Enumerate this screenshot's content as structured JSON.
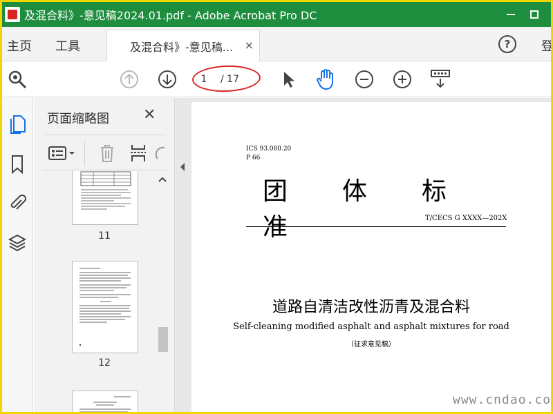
{
  "window": {
    "title": "及混合料》-意见稿2024.01.pdf - Adobe Acrobat Pro DC",
    "watermark_top": "cndao"
  },
  "menu": {
    "home": "主页",
    "tools": "工具",
    "login": "登"
  },
  "tab": {
    "label": "及混合料》-意见稿...",
    "close": "×"
  },
  "toolbar": {
    "current_page": "1",
    "total_pages": "/ 17"
  },
  "sidebar": {
    "title": "页面缩略图",
    "close": "✕",
    "thumbnails": [
      {
        "label": "11"
      },
      {
        "label": "12"
      }
    ]
  },
  "document": {
    "ics": "ICS 93.080.20",
    "p_code": "P 66",
    "heading_chars": [
      "团",
      "体",
      "标",
      "准"
    ],
    "standard_code": "T/CECS G XXXX—202X",
    "title_cn": "道路自清洁改性沥青及混合料",
    "title_en": "Self-cleaning modified asphalt and asphalt mixtures for road",
    "draft_note": "（征求意见稿）"
  },
  "footer": {
    "watermark": "www.cndao.com"
  },
  "colors": {
    "titlebar": "#1e8e3e",
    "frame": "#f2d600",
    "accent_blue": "#1473e6",
    "annotation_red": "#dd2222"
  }
}
